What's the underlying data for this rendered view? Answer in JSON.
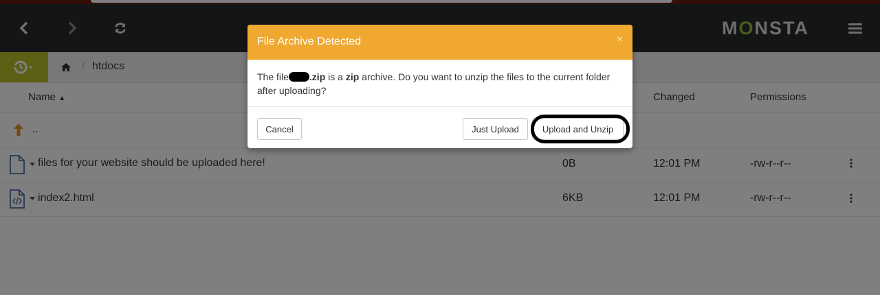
{
  "toolbar": {
    "back_icon": "chevron-left-icon",
    "forward_icon": "chevron-right-icon",
    "refresh_icon": "refresh-icon",
    "logo_prefix": "M",
    "logo_o": "O",
    "logo_suffix": "NSTA",
    "menu_icon": "hamburger-icon"
  },
  "pathbar": {
    "history_icon": "history-icon",
    "home_icon": "home-icon",
    "separator": "/",
    "crumb": "htdocs"
  },
  "columns": {
    "name": "Name",
    "sort_indicator": "▲",
    "changed": "Changed",
    "permissions": "Permissions"
  },
  "files": [
    {
      "name": "..",
      "icon": "parent-folder-icon"
    },
    {
      "name": "files for your website should be uploaded here!",
      "size": "0B",
      "changed": "12:01 PM",
      "permissions": "-rw-r--r--",
      "icon": "file-icon"
    },
    {
      "name": "index2.html",
      "size": "6KB",
      "changed": "12:01 PM",
      "permissions": "-rw-r--r--",
      "icon": "code-file-icon"
    }
  ],
  "modal": {
    "title": "File Archive Detected",
    "close": "×",
    "msg_1": "The file",
    "msg_2": ".zip",
    "msg_3": " is a ",
    "msg_4": "zip",
    "msg_5": " archive. Do you want to unzip the files to the current folder after uploading?",
    "cancel": "Cancel",
    "just_upload": "Just Upload",
    "upload_unzip": "Upload and Unzip"
  },
  "colors": {
    "topbar": "#262a2d",
    "accent_green": "#b6c02a",
    "modal_header": "#f0a830"
  }
}
